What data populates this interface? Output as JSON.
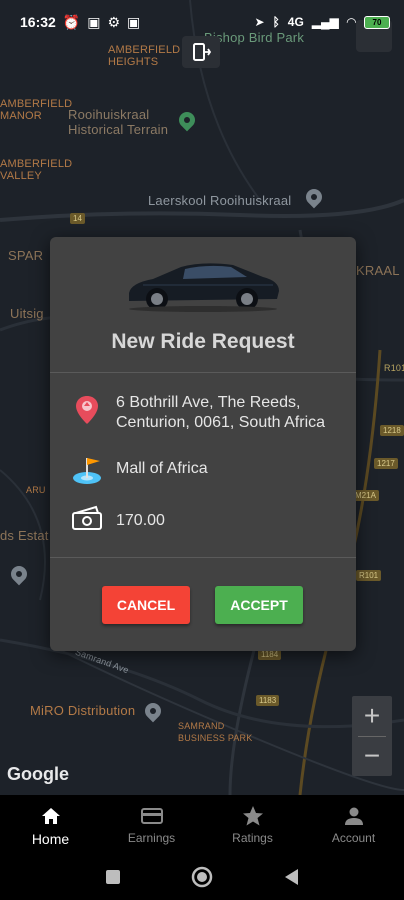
{
  "status_bar": {
    "time": "16:32",
    "network": "4G",
    "battery": "70"
  },
  "map": {
    "labels": {
      "amberfield_heights": "AMBERFIELD\nHEIGHTS",
      "bishop_bird_park": "Bishop Bird Park",
      "amberfield_manor": "AMBERFIELD\nMANOR",
      "rooihuiskraal_terrain": "Rooihuiskraal\nHistorical Terrain",
      "amberfield_valley": "AMBERFIELD\nVALLEY",
      "laerskool": "Laerskool Rooihuiskraal",
      "spar": "SPAR",
      "kraal": "KRAAL",
      "uitsig": "Uitsig",
      "aru": "ARU",
      "ds_estate": "ds Estat",
      "samrand_ave": "Samrand Ave",
      "miro": "MiRO Distribution",
      "samrand_park": "SAMRAND\nBUSINESS PARK",
      "road_14": "14",
      "road_r101": "R101",
      "road_1218": "1218",
      "road_1217": "1217",
      "road_m21a": "M21A",
      "road_r101b": "R101",
      "road_1184": "1184",
      "road_1183": "1183"
    },
    "attribution": "Google",
    "zoom_in": "+",
    "zoom_out": "−"
  },
  "dialog": {
    "title": "New Ride Request",
    "pickup": "6 Bothrill Ave, The Reeds, Centurion, 0061, South Africa",
    "destination": "Mall of Africa",
    "fare": "170.00",
    "cancel_label": "CANCEL",
    "accept_label": "ACCEPT",
    "colors": {
      "cancel": "#f44336",
      "accept": "#4caf50"
    }
  },
  "bottom_nav": {
    "items": [
      {
        "label": "Home",
        "icon": "home-icon"
      },
      {
        "label": "Earnings",
        "icon": "credit-card-icon"
      },
      {
        "label": "Ratings",
        "icon": "star-icon"
      },
      {
        "label": "Account",
        "icon": "person-icon"
      }
    ]
  }
}
